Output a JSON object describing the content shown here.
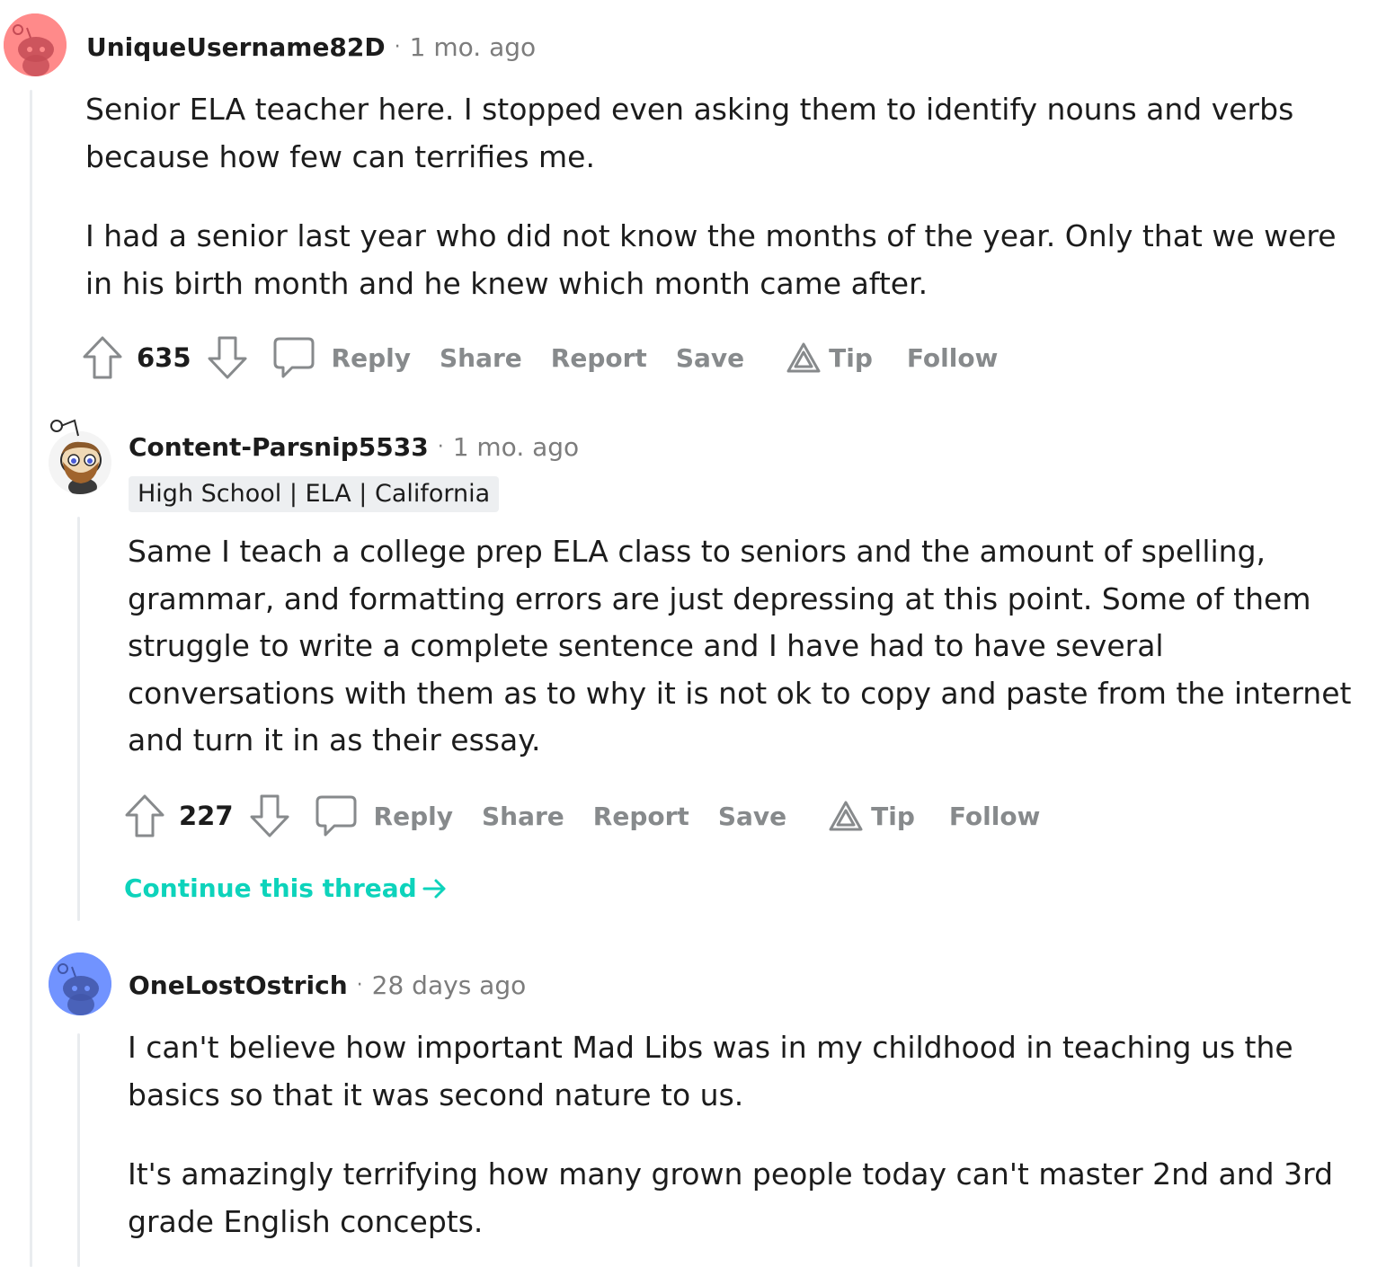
{
  "comments": [
    {
      "username": "UniqueUsername82D",
      "separator": "·",
      "time": "1 mo. ago",
      "avatar_color": "#ff8a8a",
      "paragraphs": [
        "Senior ELA teacher here. I stopped even asking them to identify nouns and verbs because how few can terrifies me.",
        "I had a senior last year who did not know the months of the year. Only that we were in his birth month and he knew which month came after."
      ],
      "score": "635",
      "actions": {
        "reply": "Reply",
        "share": "Share",
        "report": "Report",
        "save": "Save",
        "tip": "Tip",
        "follow": "Follow"
      }
    },
    {
      "username": "Content-Parsnip5533",
      "separator": "·",
      "time": "1 mo. ago",
      "flair": "High School | ELA | California",
      "paragraphs": [
        "Same I teach a college prep ELA class to seniors and the amount of spelling, grammar, and formatting errors are just depressing at this point. Some of them struggle to write a complete sentence and I have had to have several conversations with them as to why it is not ok to copy and paste from the internet and turn it in as their essay."
      ],
      "score": "227",
      "actions": {
        "reply": "Reply",
        "share": "Share",
        "report": "Report",
        "save": "Save",
        "tip": "Tip",
        "follow": "Follow"
      },
      "continue_thread": "Continue this thread"
    },
    {
      "username": "OneLostOstrich",
      "separator": "·",
      "time": "28 days ago",
      "avatar_color": "#7193ff",
      "paragraphs": [
        "I can't believe how important Mad Libs was in my childhood in teaching us the basics so that it was second nature to us.",
        "It's amazingly terrifying how many grown people today can't master 2nd and 3rd grade English concepts."
      ]
    }
  ],
  "colors": {
    "text": "#1c1c1c",
    "muted": "#7c7c7c",
    "action": "#878a8c",
    "thread_line": "#e9ecef",
    "continue_link": "#0dd3bb",
    "flair_bg": "#edeff1"
  }
}
